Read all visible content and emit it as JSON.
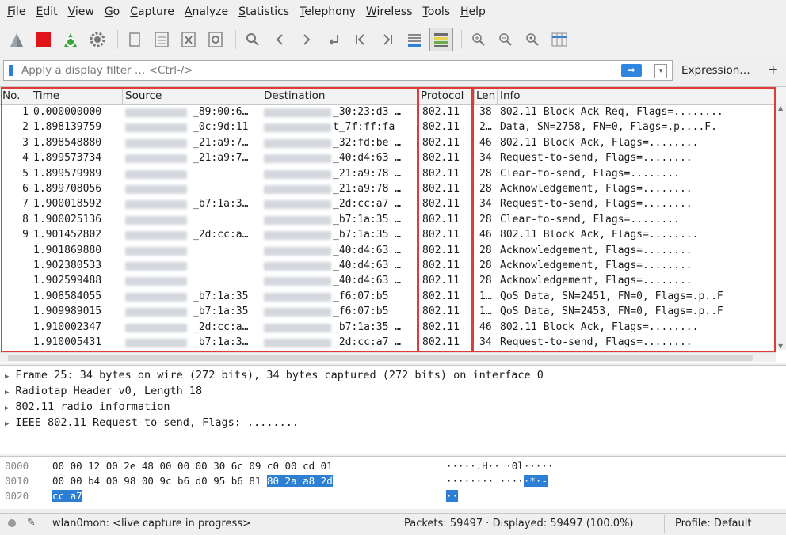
{
  "menu": [
    "File",
    "Edit",
    "View",
    "Go",
    "Capture",
    "Analyze",
    "Statistics",
    "Telephony",
    "Wireless",
    "Tools",
    "Help"
  ],
  "toolbar_icons": [
    "shark-fin-start-icon",
    "stop-square-icon",
    "restart-capture-icon",
    "gear-options-icon",
    "open-file-icon",
    "save-file-icon",
    "close-file-icon",
    "reload-icon",
    "find-icon",
    "back-arrow-icon",
    "forward-arrow-icon",
    "goto-packet-icon",
    "first-packet-icon",
    "last-packet-icon",
    "autoscroll-icon",
    "colorize-icon",
    "zoom-in-icon",
    "zoom-out-icon",
    "zoom-normal-icon",
    "resize-columns-icon"
  ],
  "filter": {
    "placeholder": "Apply a display filter … <Ctrl-/>",
    "expression_label": "Expression…",
    "plus_label": "+"
  },
  "columns": {
    "no": "No.",
    "time": "Time",
    "source": "Source",
    "destination": "Destination",
    "protocol": "Protocol",
    "length": "Len",
    "info": "Info"
  },
  "packets": [
    {
      "no": "1",
      "time": "0.000000000",
      "src": "_89:00:6…",
      "dst": "_30:23:d3 …",
      "proto": "802.11",
      "len": "38",
      "info": "802.11 Block Ack Req, Flags=........"
    },
    {
      "no": "2",
      "time": "1.898139759",
      "src": "_0c:9d:11",
      "dst": "t_7f:ff:fa",
      "proto": "802.11",
      "len": "2…",
      "info": "Data, SN=2758, FN=0, Flags=.p....F."
    },
    {
      "no": "3",
      "time": "1.898548880",
      "src": "_21:a9:7…",
      "dst": "_32:fd:be …",
      "proto": "802.11",
      "len": "46",
      "info": "802.11 Block Ack, Flags=........"
    },
    {
      "no": "4",
      "time": "1.899573734",
      "src": "_21:a9:7…",
      "dst": "_40:d4:63 …",
      "proto": "802.11",
      "len": "34",
      "info": "Request-to-send, Flags=........"
    },
    {
      "no": "5",
      "time": "1.899579989",
      "src": "",
      "dst": "_21:a9:78 …",
      "proto": "802.11",
      "len": "28",
      "info": "Clear-to-send, Flags=........"
    },
    {
      "no": "6",
      "time": "1.899708056",
      "src": "",
      "dst": "_21:a9:78 …",
      "proto": "802.11",
      "len": "28",
      "info": "Acknowledgement, Flags=........"
    },
    {
      "no": "7",
      "time": "1.900018592",
      "src": "_b7:1a:3…",
      "dst": "_2d:cc:a7 …",
      "proto": "802.11",
      "len": "34",
      "info": "Request-to-send, Flags=........"
    },
    {
      "no": "8",
      "time": "1.900025136",
      "src": "",
      "dst": "_b7:1a:35 …",
      "proto": "802.11",
      "len": "28",
      "info": "Clear-to-send, Flags=........"
    },
    {
      "no": "9",
      "time": "1.901452802",
      "src": "_2d:cc:a…",
      "dst": "_b7:1a:35 …",
      "proto": "802.11",
      "len": "46",
      "info": "802.11 Block Ack, Flags=........"
    },
    {
      "no": "",
      "time": "1.901869880",
      "src": "",
      "dst": "_40:d4:63 …",
      "proto": "802.11",
      "len": "28",
      "info": "Acknowledgement, Flags=........"
    },
    {
      "no": "",
      "time": "1.902380533",
      "src": "",
      "dst": "_40:d4:63 …",
      "proto": "802.11",
      "len": "28",
      "info": "Acknowledgement, Flags=........"
    },
    {
      "no": "",
      "time": "1.902599488",
      "src": "",
      "dst": "_40:d4:63 …",
      "proto": "802.11",
      "len": "28",
      "info": "Acknowledgement, Flags=........"
    },
    {
      "no": "",
      "time": "1.908584055",
      "src": "_b7:1a:35",
      "dst": "_f6:07:b5",
      "proto": "802.11",
      "len": "1…",
      "info": "QoS Data, SN=2451, FN=0, Flags=.p..F"
    },
    {
      "no": "",
      "time": "1.909989015",
      "src": "_b7:1a:35",
      "dst": "_f6:07:b5",
      "proto": "802.11",
      "len": "1…",
      "info": "QoS Data, SN=2453, FN=0, Flags=.p..F"
    },
    {
      "no": "",
      "time": "1.910002347",
      "src": "_2d:cc:a…",
      "dst": "_b7:1a:35 …",
      "proto": "802.11",
      "len": "46",
      "info": "802.11 Block Ack, Flags=........"
    },
    {
      "no": "",
      "time": "1.910005431",
      "src": "_b7:1a:3…",
      "dst": "_2d:cc:a7 …",
      "proto": "802.11",
      "len": "34",
      "info": "Request-to-send, Flags=........"
    }
  ],
  "details": [
    "Frame 25: 34 bytes on wire (272 bits), 34 bytes captured (272 bits) on interface 0",
    "Radiotap Header v0, Length 18",
    "802.11 radio information",
    "IEEE 802.11 Request-to-send, Flags: ........"
  ],
  "bytes": [
    {
      "off": "0000",
      "hex": "00 00 12 00 2e 48 00 00  00 30 6c 09 c0 00 cd 01",
      "hex_hl": "",
      "ascii": "·····.H·· ·0l·····",
      "ascii_hl": ""
    },
    {
      "off": "0010",
      "hex": "00 00 b4 00 98 00 9c b6  d0 95 b6 81 ",
      "hex_hl": "80 2a a8 2d",
      "ascii": "········ ····",
      "ascii_hl": "·*·-"
    },
    {
      "off": "0020",
      "hex": "",
      "hex_hl": "cc a7",
      "ascii": "",
      "ascii_hl": "··"
    }
  ],
  "status": {
    "capture": "wlan0mon: <live capture in progress>",
    "packets": "Packets: 59497 · Displayed: 59497 (100.0%)",
    "profile": "Profile: Default"
  },
  "colors": {
    "highlight_box": "#e03a3a",
    "byte_highlight": "#2d7fd3"
  }
}
